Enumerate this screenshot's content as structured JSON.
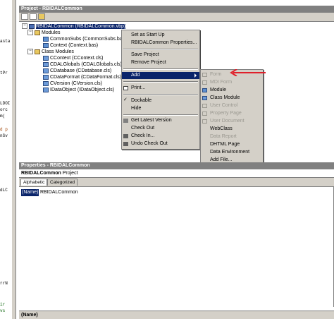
{
  "colors": {
    "highlight": "#0a246a",
    "menu_bg": "#d4d0c8",
    "disabled": "#9a9890",
    "arrow": "#e0202a"
  },
  "code_fragments": [
    "asta",
    "tPr",
    "LDOI",
    "orc",
    "m(",
    "d p",
    "nSv",
    "dLC",
    "rrN",
    "ir",
    "vs"
  ],
  "project_window": {
    "title": "Project - RBIDALCommon",
    "tree": {
      "root": "RBIDALCommon (RBIDALCommon.vbp)",
      "folders": [
        {
          "label": "Modules",
          "items": [
            "CommonSubs (CommonSubs.bas)",
            "Context (Context.bas)"
          ]
        },
        {
          "label": "Class Modules",
          "items": [
            "CContext (CContext.cls)",
            "CDALGlobals (CDALGlobals.cls)",
            "CDatabase (CDatabase.cls)",
            "CDataFormat (CDataFormat.cls)",
            "CVersion (CVersion.cls)",
            "IDataObject (IDataObject.cls)"
          ]
        }
      ]
    }
  },
  "context_menu": {
    "items": [
      "Set as Start Up",
      "RBIDALCommon Properties...",
      "Save Project",
      "Remove Project",
      "Add",
      "Print...",
      "Dockable",
      "Hide",
      "Get Latest Version",
      "Check Out",
      "Check In...",
      "Undo Check Out"
    ]
  },
  "add_submenu": {
    "items": [
      {
        "label": "Form",
        "enabled": false
      },
      {
        "label": "MDI Form",
        "enabled": false
      },
      {
        "label": "Module",
        "enabled": true
      },
      {
        "label": "Class Module",
        "enabled": true
      },
      {
        "label": "User Control",
        "enabled": false
      },
      {
        "label": "Property Page",
        "enabled": false
      },
      {
        "label": "User Document",
        "enabled": false
      },
      {
        "label": "WebClass",
        "enabled": true
      },
      {
        "label": "Data Report",
        "enabled": false
      },
      {
        "label": "DHTML Page",
        "enabled": true
      },
      {
        "label": "Data Environment",
        "enabled": true
      },
      {
        "label": "Add File...",
        "enabled": true
      }
    ]
  },
  "properties_window": {
    "title": "Properties - RBIDALCommon",
    "object_name": "RBIDALCommon",
    "object_type": "Project",
    "tabs": [
      "Alphabetic",
      "Categorized"
    ],
    "rows": [
      {
        "name": "(Name)",
        "value": "RBIDALCommon"
      }
    ],
    "description_title": "(Name)"
  }
}
